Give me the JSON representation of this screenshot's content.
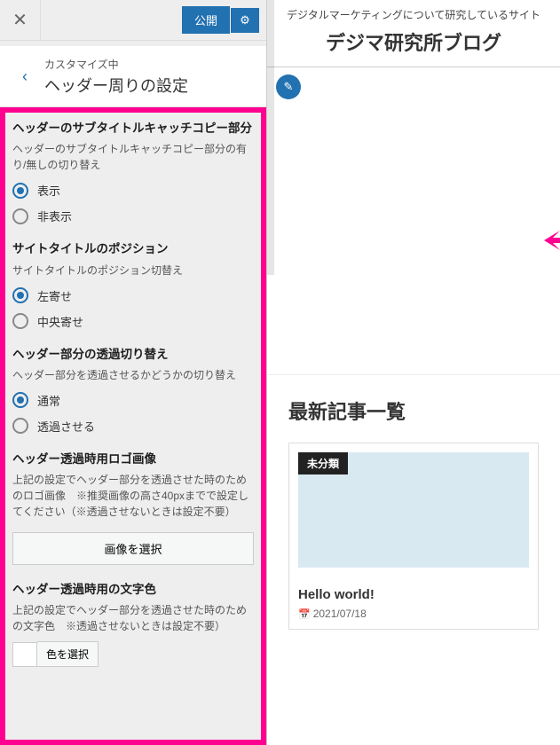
{
  "topbar": {
    "close": "✕",
    "publish": "公開",
    "gear_icon": "⚙"
  },
  "section_header": {
    "back": "‹",
    "subtitle": "カスタマイズ中",
    "title": "ヘッダー周りの設定"
  },
  "controls": {
    "subtitle_catch": {
      "label": "ヘッダーのサブタイトルキャッチコピー部分",
      "desc": "ヘッダーのサブタイトルキャッチコピー部分の有り/無しの切り替え",
      "opt_show": "表示",
      "opt_hide": "非表示"
    },
    "title_position": {
      "label": "サイトタイトルのポジション",
      "desc": "サイトタイトルのポジション切替え",
      "opt_left": "左寄せ",
      "opt_center": "中央寄せ"
    },
    "header_transparent": {
      "label": "ヘッダー部分の透過切り替え",
      "desc": "ヘッダー部分を透過させるかどうかの切り替え",
      "opt_normal": "通常",
      "opt_trans": "透過させる"
    },
    "trans_logo": {
      "label": "ヘッダー透過時用ロゴ画像",
      "desc": "上記の設定でヘッダー部分を透過させた時のためのロゴ画像　※推奨画像の高さ40pxまでで設定してください（※透過させないときは設定不要）",
      "button": "画像を選択"
    },
    "trans_color": {
      "label": "ヘッダー透過時用の文字色",
      "desc": "上記の設定でヘッダー部分を透過させた時のための文字色　※透過させないときは設定不要）",
      "button": "色を選択"
    }
  },
  "preview": {
    "tagline": "デジタルマーケティングについて研究しているサイト",
    "site_title": "デジマ研究所ブログ",
    "edit_icon": "✎",
    "posts_heading": "最新記事一覧",
    "post": {
      "category": "未分類",
      "title": "Hello world!",
      "date": "2021/07/18"
    }
  }
}
